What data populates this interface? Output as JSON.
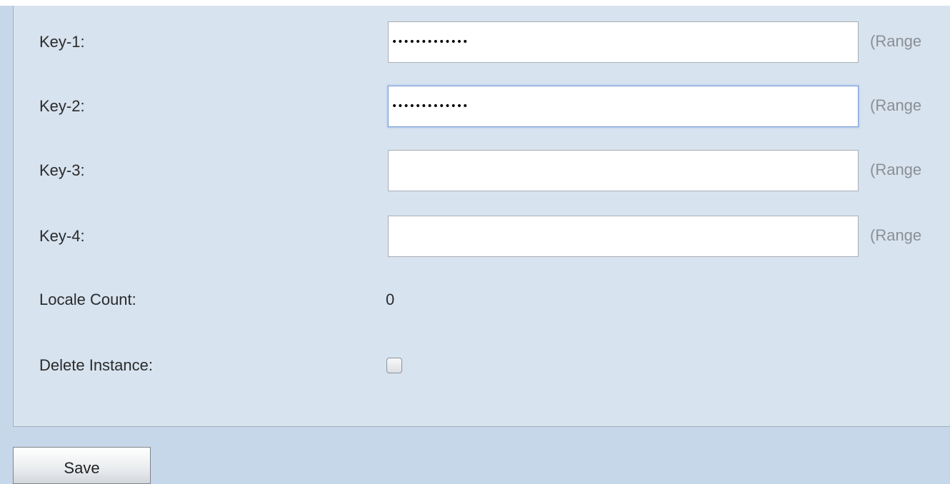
{
  "form": {
    "key1": {
      "label": "Key-1:",
      "value": "•••••••••••••",
      "range_hint": "(Range"
    },
    "key2": {
      "label": "Key-2:",
      "value": "•••••••••••••",
      "range_hint": "(Range"
    },
    "key3": {
      "label": "Key-3:",
      "value": "",
      "range_hint": "(Range"
    },
    "key4": {
      "label": "Key-4:",
      "value": "",
      "range_hint": "(Range"
    },
    "locale_count": {
      "label": "Locale Count:",
      "value": "0"
    },
    "delete_instance": {
      "label": "Delete Instance:",
      "checked": false
    }
  },
  "footer": {
    "save_label": "Save"
  },
  "colors": {
    "panel_background": "#d7e3ef",
    "page_background": "#c6d7e9",
    "focus_border": "#7b9ed6",
    "hint_text": "#8b8f94"
  }
}
